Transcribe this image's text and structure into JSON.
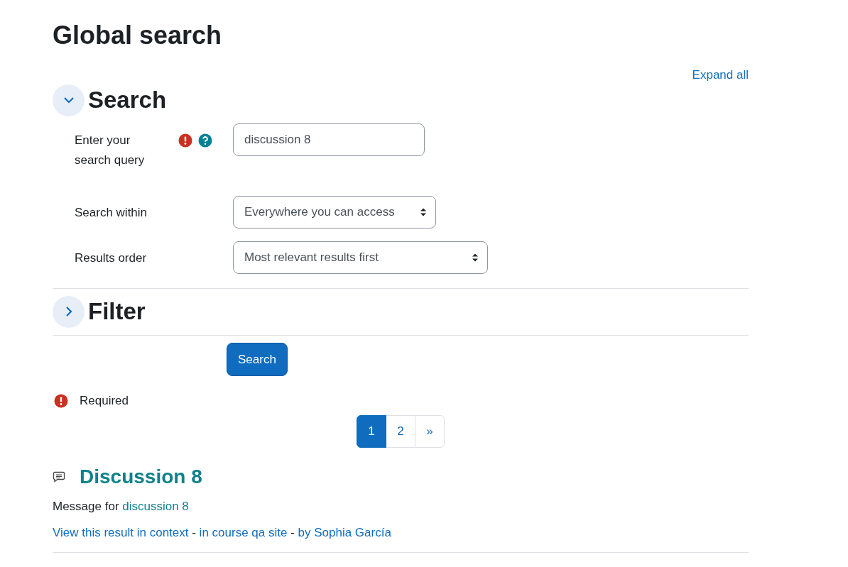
{
  "page_title": "Global search",
  "expand_all": "Expand all",
  "sections": [
    {
      "title": "Search",
      "expanded": true,
      "fields": [
        {
          "kind": "text",
          "label": "Enter your search query",
          "required": true,
          "help": true,
          "value": "discussion 8"
        },
        {
          "kind": "select",
          "label": "Search within",
          "value": "Everywhere you can access"
        },
        {
          "kind": "select",
          "label": "Results order",
          "value": "Most relevant results first"
        }
      ]
    },
    {
      "title": "Filter",
      "expanded": false
    }
  ],
  "submit": "Search",
  "required_note": "Required",
  "pagination": [
    {
      "label": "1",
      "selected": true
    },
    {
      "label": "2",
      "selected": false
    },
    {
      "label": "»",
      "selected": false
    }
  ],
  "results": [
    {
      "title": "Discussion 8",
      "message_prefix": "Message for",
      "message_link": "discussion 8",
      "links": [
        "View this result in context",
        "in course qa site",
        "by Sophia García"
      ],
      "separators": [
        "-",
        "-"
      ]
    }
  ]
}
